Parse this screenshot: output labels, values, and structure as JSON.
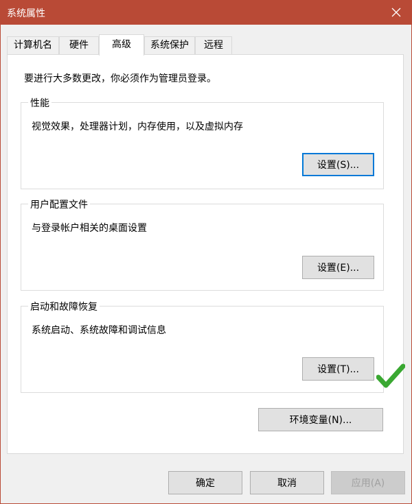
{
  "window": {
    "title": "系统属性"
  },
  "tabs": [
    {
      "label": "计算机名"
    },
    {
      "label": "硬件"
    },
    {
      "label": "高级",
      "active": true
    },
    {
      "label": "系统保护"
    },
    {
      "label": "远程"
    }
  ],
  "advanced": {
    "intro": "要进行大多数更改，你必须作为管理员登录。",
    "performance": {
      "title": "性能",
      "description": "视觉效果，处理器计划，内存使用，以及虚拟内存",
      "button": "设置(S)..."
    },
    "user_profiles": {
      "title": "用户配置文件",
      "description": "与登录帐户相关的桌面设置",
      "button": "设置(E)..."
    },
    "startup_recovery": {
      "title": "启动和故障恢复",
      "description": "系统启动、系统故障和调试信息",
      "button": "设置(T)..."
    },
    "env_button": "环境变量(N)..."
  },
  "footer": {
    "ok": "确定",
    "cancel": "取消",
    "apply": "应用(A)"
  },
  "colors": {
    "titlebar": "#b94a36",
    "checkmark": "#3aa832",
    "focus": "#0078d7"
  }
}
